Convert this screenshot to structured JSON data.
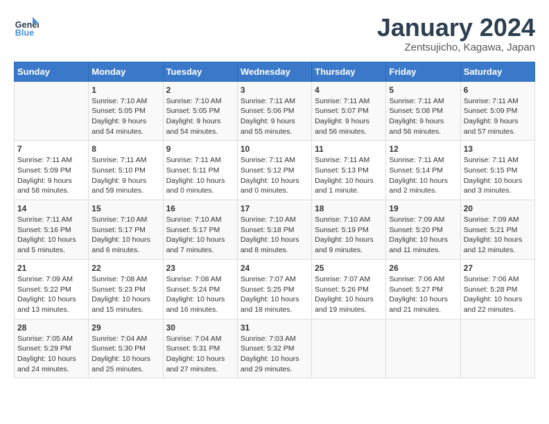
{
  "logo": {
    "text_general": "General",
    "text_blue": "Blue"
  },
  "title": "January 2024",
  "subtitle": "Zentsujicho, Kagawa, Japan",
  "headers": [
    "Sunday",
    "Monday",
    "Tuesday",
    "Wednesday",
    "Thursday",
    "Friday",
    "Saturday"
  ],
  "weeks": [
    [
      {
        "day": "",
        "sunrise": "",
        "sunset": "",
        "daylight": ""
      },
      {
        "day": "1",
        "sunrise": "Sunrise: 7:10 AM",
        "sunset": "Sunset: 5:05 PM",
        "daylight": "Daylight: 9 hours and 54 minutes."
      },
      {
        "day": "2",
        "sunrise": "Sunrise: 7:10 AM",
        "sunset": "Sunset: 5:05 PM",
        "daylight": "Daylight: 9 hours and 54 minutes."
      },
      {
        "day": "3",
        "sunrise": "Sunrise: 7:11 AM",
        "sunset": "Sunset: 5:06 PM",
        "daylight": "Daylight: 9 hours and 55 minutes."
      },
      {
        "day": "4",
        "sunrise": "Sunrise: 7:11 AM",
        "sunset": "Sunset: 5:07 PM",
        "daylight": "Daylight: 9 hours and 56 minutes."
      },
      {
        "day": "5",
        "sunrise": "Sunrise: 7:11 AM",
        "sunset": "Sunset: 5:08 PM",
        "daylight": "Daylight: 9 hours and 56 minutes."
      },
      {
        "day": "6",
        "sunrise": "Sunrise: 7:11 AM",
        "sunset": "Sunset: 5:09 PM",
        "daylight": "Daylight: 9 hours and 57 minutes."
      }
    ],
    [
      {
        "day": "7",
        "sunrise": "Sunrise: 7:11 AM",
        "sunset": "Sunset: 5:09 PM",
        "daylight": "Daylight: 9 hours and 58 minutes."
      },
      {
        "day": "8",
        "sunrise": "Sunrise: 7:11 AM",
        "sunset": "Sunset: 5:10 PM",
        "daylight": "Daylight: 9 hours and 59 minutes."
      },
      {
        "day": "9",
        "sunrise": "Sunrise: 7:11 AM",
        "sunset": "Sunset: 5:11 PM",
        "daylight": "Daylight: 10 hours and 0 minutes."
      },
      {
        "day": "10",
        "sunrise": "Sunrise: 7:11 AM",
        "sunset": "Sunset: 5:12 PM",
        "daylight": "Daylight: 10 hours and 0 minutes."
      },
      {
        "day": "11",
        "sunrise": "Sunrise: 7:11 AM",
        "sunset": "Sunset: 5:13 PM",
        "daylight": "Daylight: 10 hours and 1 minute."
      },
      {
        "day": "12",
        "sunrise": "Sunrise: 7:11 AM",
        "sunset": "Sunset: 5:14 PM",
        "daylight": "Daylight: 10 hours and 2 minutes."
      },
      {
        "day": "13",
        "sunrise": "Sunrise: 7:11 AM",
        "sunset": "Sunset: 5:15 PM",
        "daylight": "Daylight: 10 hours and 3 minutes."
      }
    ],
    [
      {
        "day": "14",
        "sunrise": "Sunrise: 7:11 AM",
        "sunset": "Sunset: 5:16 PM",
        "daylight": "Daylight: 10 hours and 5 minutes."
      },
      {
        "day": "15",
        "sunrise": "Sunrise: 7:10 AM",
        "sunset": "Sunset: 5:17 PM",
        "daylight": "Daylight: 10 hours and 6 minutes."
      },
      {
        "day": "16",
        "sunrise": "Sunrise: 7:10 AM",
        "sunset": "Sunset: 5:17 PM",
        "daylight": "Daylight: 10 hours and 7 minutes."
      },
      {
        "day": "17",
        "sunrise": "Sunrise: 7:10 AM",
        "sunset": "Sunset: 5:18 PM",
        "daylight": "Daylight: 10 hours and 8 minutes."
      },
      {
        "day": "18",
        "sunrise": "Sunrise: 7:10 AM",
        "sunset": "Sunset: 5:19 PM",
        "daylight": "Daylight: 10 hours and 9 minutes."
      },
      {
        "day": "19",
        "sunrise": "Sunrise: 7:09 AM",
        "sunset": "Sunset: 5:20 PM",
        "daylight": "Daylight: 10 hours and 11 minutes."
      },
      {
        "day": "20",
        "sunrise": "Sunrise: 7:09 AM",
        "sunset": "Sunset: 5:21 PM",
        "daylight": "Daylight: 10 hours and 12 minutes."
      }
    ],
    [
      {
        "day": "21",
        "sunrise": "Sunrise: 7:09 AM",
        "sunset": "Sunset: 5:22 PM",
        "daylight": "Daylight: 10 hours and 13 minutes."
      },
      {
        "day": "22",
        "sunrise": "Sunrise: 7:08 AM",
        "sunset": "Sunset: 5:23 PM",
        "daylight": "Daylight: 10 hours and 15 minutes."
      },
      {
        "day": "23",
        "sunrise": "Sunrise: 7:08 AM",
        "sunset": "Sunset: 5:24 PM",
        "daylight": "Daylight: 10 hours and 16 minutes."
      },
      {
        "day": "24",
        "sunrise": "Sunrise: 7:07 AM",
        "sunset": "Sunset: 5:25 PM",
        "daylight": "Daylight: 10 hours and 18 minutes."
      },
      {
        "day": "25",
        "sunrise": "Sunrise: 7:07 AM",
        "sunset": "Sunset: 5:26 PM",
        "daylight": "Daylight: 10 hours and 19 minutes."
      },
      {
        "day": "26",
        "sunrise": "Sunrise: 7:06 AM",
        "sunset": "Sunset: 5:27 PM",
        "daylight": "Daylight: 10 hours and 21 minutes."
      },
      {
        "day": "27",
        "sunrise": "Sunrise: 7:06 AM",
        "sunset": "Sunset: 5:28 PM",
        "daylight": "Daylight: 10 hours and 22 minutes."
      }
    ],
    [
      {
        "day": "28",
        "sunrise": "Sunrise: 7:05 AM",
        "sunset": "Sunset: 5:29 PM",
        "daylight": "Daylight: 10 hours and 24 minutes."
      },
      {
        "day": "29",
        "sunrise": "Sunrise: 7:04 AM",
        "sunset": "Sunset: 5:30 PM",
        "daylight": "Daylight: 10 hours and 25 minutes."
      },
      {
        "day": "30",
        "sunrise": "Sunrise: 7:04 AM",
        "sunset": "Sunset: 5:31 PM",
        "daylight": "Daylight: 10 hours and 27 minutes."
      },
      {
        "day": "31",
        "sunrise": "Sunrise: 7:03 AM",
        "sunset": "Sunset: 5:32 PM",
        "daylight": "Daylight: 10 hours and 29 minutes."
      },
      {
        "day": "",
        "sunrise": "",
        "sunset": "",
        "daylight": ""
      },
      {
        "day": "",
        "sunrise": "",
        "sunset": "",
        "daylight": ""
      },
      {
        "day": "",
        "sunrise": "",
        "sunset": "",
        "daylight": ""
      }
    ]
  ]
}
